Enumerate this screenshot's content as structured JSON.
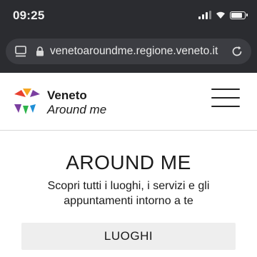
{
  "status_bar": {
    "time": "09:25"
  },
  "browser": {
    "url": "venetoaroundme.regione.veneto.it",
    "icons": [
      "tab-switcher-icon",
      "lock-icon",
      "reload-icon"
    ]
  },
  "site": {
    "logo": {
      "line1": "Veneto",
      "line2": "Around me",
      "colors": [
        "#e8402f",
        "#f5a623",
        "#2db34a",
        "#1f8fd6",
        "#7b3fa0"
      ]
    },
    "menu_icon": "hamburger-menu-icon"
  },
  "hero": {
    "title": "AROUND ME",
    "subtitle": "Scopri tutti i luoghi, i servizi e gli appuntamenti intorno a te",
    "button_label": "LUOGHI"
  }
}
